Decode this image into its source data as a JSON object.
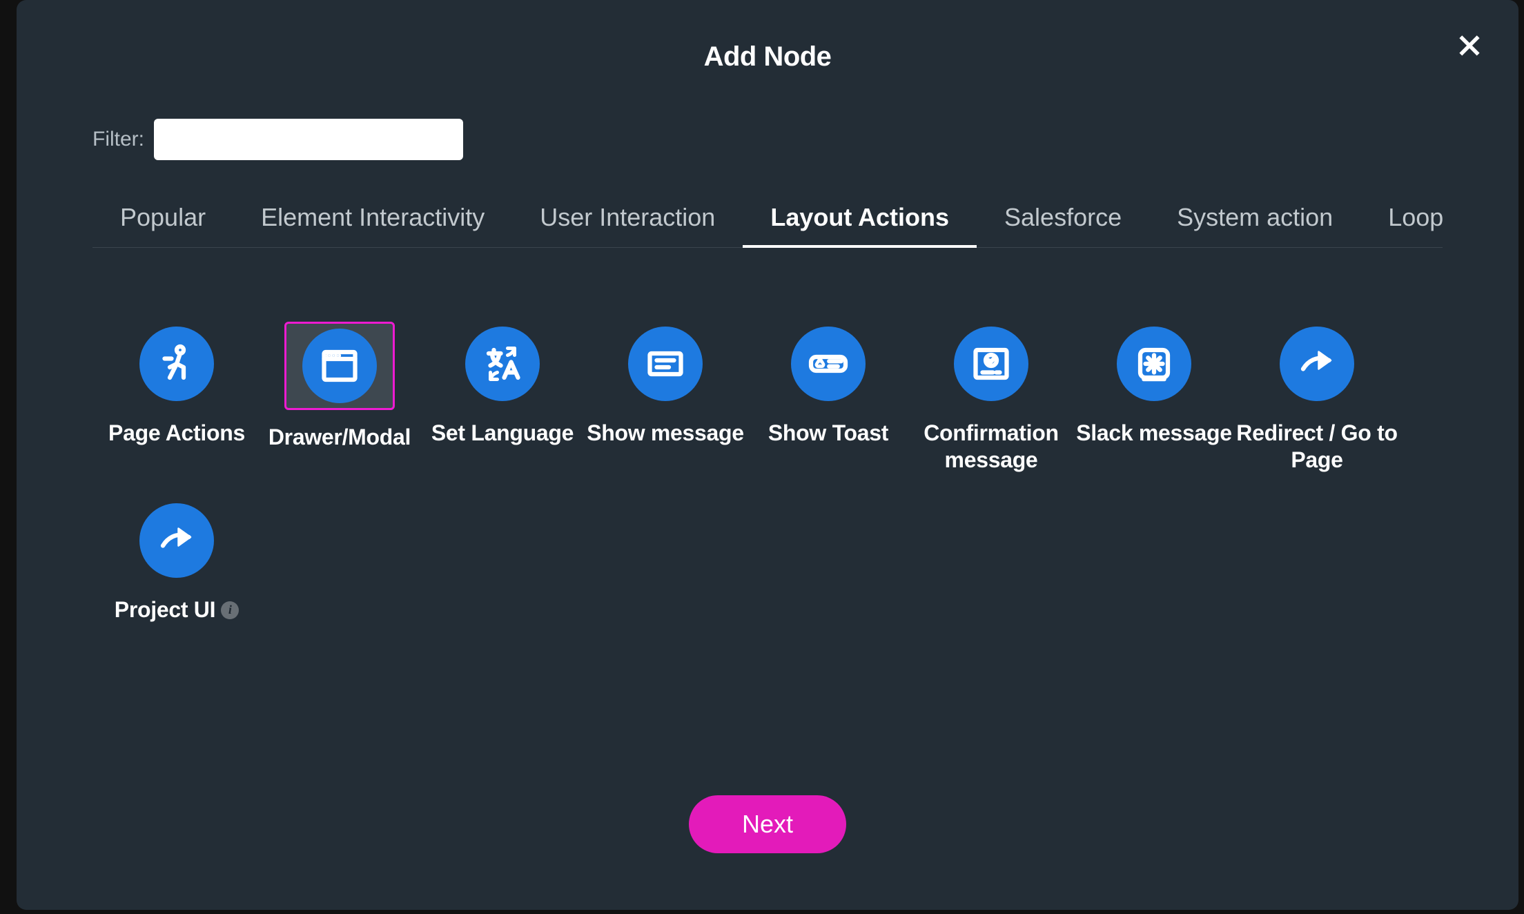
{
  "modal": {
    "title": "Add Node",
    "close_aria": "Close"
  },
  "filter": {
    "label": "Filter:",
    "value": "",
    "placeholder": ""
  },
  "tabs": [
    {
      "id": "popular",
      "label": "Popular",
      "active": false
    },
    {
      "id": "element-interactivity",
      "label": "Element Interactivity",
      "active": false
    },
    {
      "id": "user-interaction",
      "label": "User Interaction",
      "active": false
    },
    {
      "id": "layout-actions",
      "label": "Layout Actions",
      "active": true
    },
    {
      "id": "salesforce",
      "label": "Salesforce",
      "active": false
    },
    {
      "id": "system-action",
      "label": "System action",
      "active": false
    },
    {
      "id": "loop",
      "label": "Loop",
      "active": false
    }
  ],
  "nodes": [
    {
      "id": "page-actions",
      "label": "Page Actions",
      "icon": "run-person-icon",
      "selected": false,
      "info": false
    },
    {
      "id": "drawer-modal",
      "label": "Drawer/Modal",
      "icon": "window-icon",
      "selected": true,
      "info": false
    },
    {
      "id": "set-language",
      "label": "Set Language",
      "icon": "translate-icon",
      "selected": false,
      "info": false
    },
    {
      "id": "show-message",
      "label": "Show message",
      "icon": "message-box-icon",
      "selected": false,
      "info": false
    },
    {
      "id": "show-toast",
      "label": "Show Toast",
      "icon": "toast-icon",
      "selected": false,
      "info": false
    },
    {
      "id": "confirmation-message",
      "label": "Confirmation message",
      "icon": "confirm-icon",
      "selected": false,
      "info": false
    },
    {
      "id": "slack-message",
      "label": "Slack message",
      "icon": "slack-icon",
      "selected": false,
      "info": false
    },
    {
      "id": "redirect",
      "label": "Redirect / Go to Page",
      "icon": "redirect-arrow-icon",
      "selected": false,
      "info": false
    },
    {
      "id": "project-ui",
      "label": "Project UI",
      "icon": "redirect-arrow-icon",
      "selected": false,
      "info": true
    }
  ],
  "buttons": {
    "next": "Next"
  }
}
